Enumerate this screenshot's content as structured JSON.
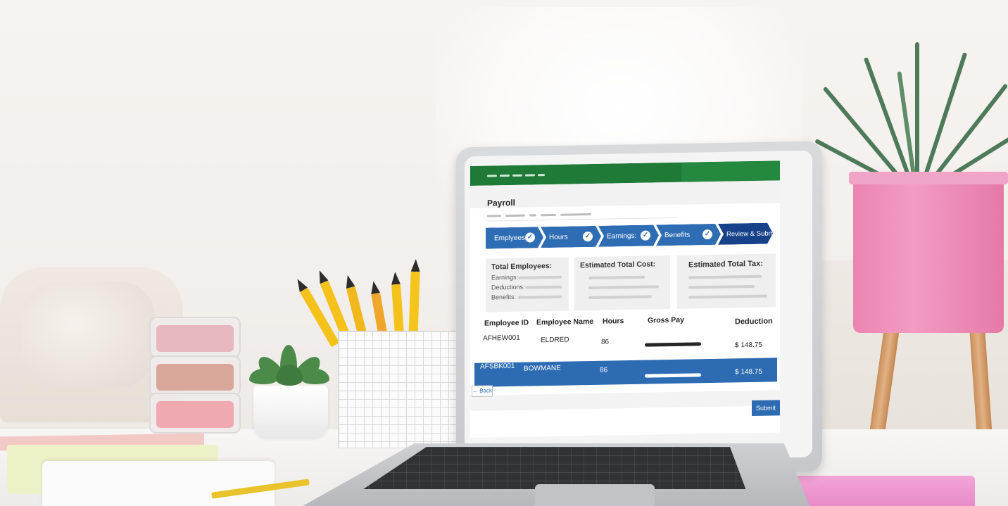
{
  "app": {
    "page_title": "Payroll"
  },
  "steps": [
    {
      "label": "Emplyees",
      "completed": true
    },
    {
      "label": "Hours",
      "completed": true
    },
    {
      "label": "Earnings:",
      "completed": true
    },
    {
      "label": "Benefits",
      "completed": true
    },
    {
      "label": "Review & Submit",
      "completed": false,
      "active": true
    }
  ],
  "check_glyph": "✓",
  "summary": {
    "employees_card": {
      "title": "Total Employees:",
      "labels": [
        "Earnings:",
        "Deductions:",
        "Benefits:"
      ]
    },
    "cost_card": {
      "title": "Estimated Total Cost:"
    },
    "tax_card": {
      "title": "Estimated Total Tax:"
    }
  },
  "table": {
    "columns": [
      "Employee ID",
      "Employee Name",
      "Hours",
      "Gross Pay",
      "Deduction"
    ],
    "rows": [
      {
        "id": "AFHEW001",
        "name": "ELDRED",
        "hours": "86",
        "deduction": "$ 148.75",
        "selected": false
      },
      {
        "id": "AFSBK001",
        "name": "BOWMANE",
        "hours": "86",
        "deduction": "$ 148.75",
        "selected": true
      }
    ]
  },
  "buttons": {
    "back": "← Back",
    "submit": "Submit"
  },
  "colors": {
    "topbar": "#1f7a38",
    "step": "#2e6db4",
    "step_active": "#17428a",
    "selected_row": "#2d6cb2",
    "pot": "#f29cc2"
  },
  "icons": {
    "step_complete": "check-circle-icon"
  }
}
